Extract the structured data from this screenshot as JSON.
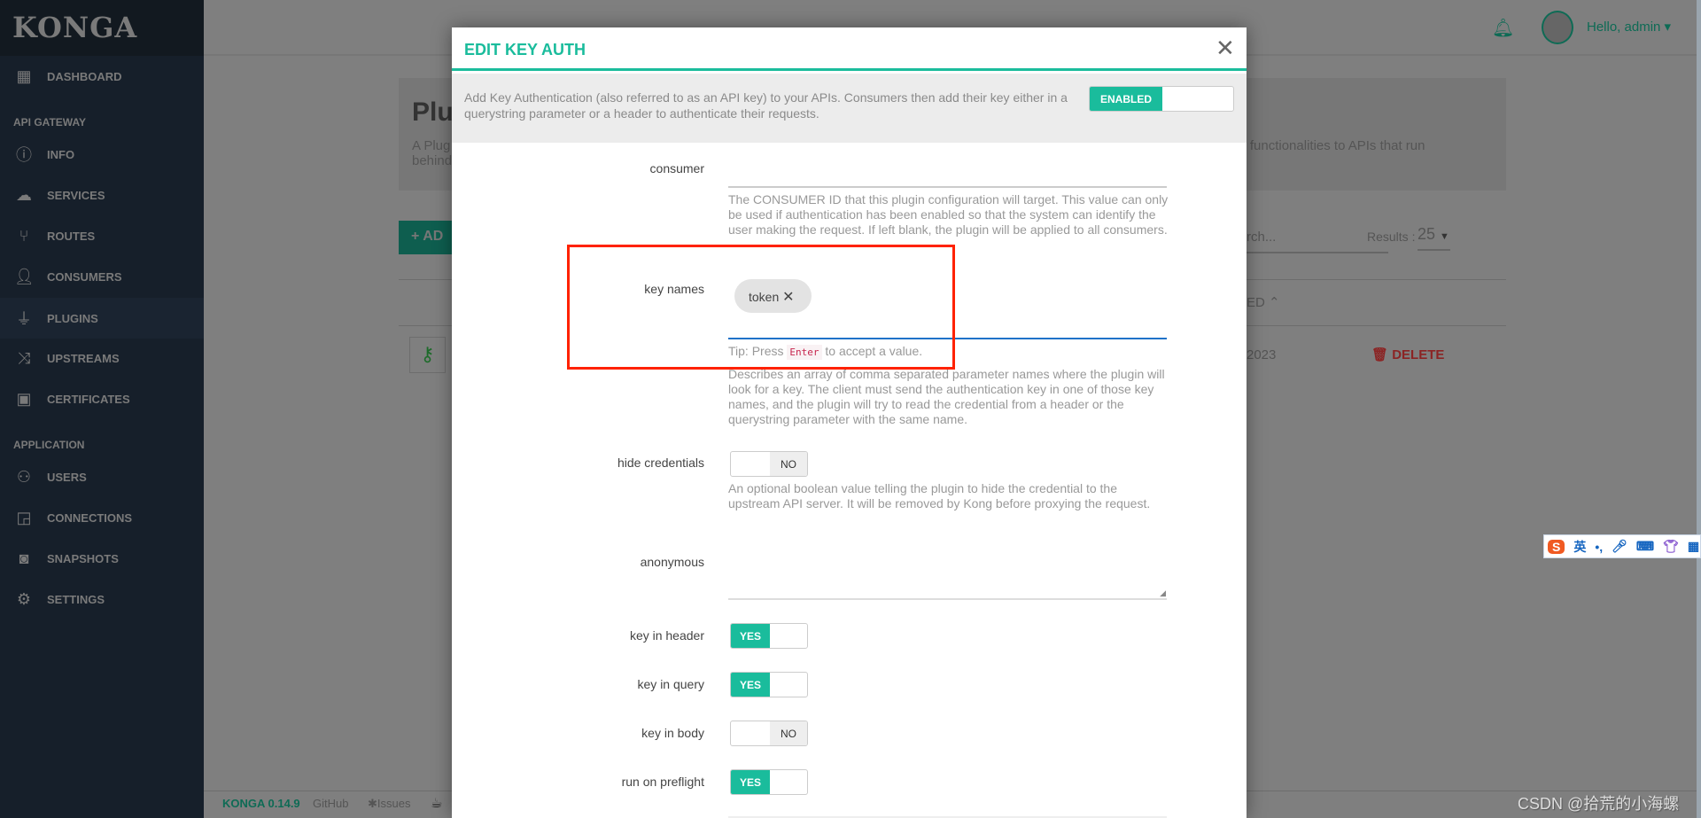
{
  "sidebar": {
    "logo": "KONGA",
    "items": [
      {
        "label": "DASHBOARD",
        "icon": "dashboard-icon"
      },
      {
        "section": "API GATEWAY"
      },
      {
        "label": "INFO",
        "icon": "info-icon"
      },
      {
        "label": "SERVICES",
        "icon": "cloud-icon"
      },
      {
        "label": "ROUTES",
        "icon": "routes-icon"
      },
      {
        "label": "CONSUMERS",
        "icon": "user-icon"
      },
      {
        "label": "PLUGINS",
        "icon": "plug-icon",
        "active": true
      },
      {
        "label": "UPSTREAMS",
        "icon": "shuffle-icon"
      },
      {
        "label": "CERTIFICATES",
        "icon": "certificate-icon"
      },
      {
        "section": "APPLICATION"
      },
      {
        "label": "USERS",
        "icon": "users-icon"
      },
      {
        "label": "CONNECTIONS",
        "icon": "cast-icon"
      },
      {
        "label": "SNAPSHOTS",
        "icon": "camera-icon"
      },
      {
        "label": "SETTINGS",
        "icon": "gear-icon"
      }
    ]
  },
  "header": {
    "greeting": "Hello, admin"
  },
  "page": {
    "title_partial": "Plu",
    "desc_left_1": "A Plug",
    "desc_left_2": "behind",
    "desc_right": "dd functionalities to APIs that run",
    "add_button_partial": "+ AD",
    "search_partial": "rch...",
    "results_label": "Results :",
    "results_value": "25",
    "sort_col_partial": "ED",
    "row_date_partial": "2023",
    "delete_label": "DELETE"
  },
  "footer": {
    "version": "KONGA 0.14.9",
    "github": "GitHub",
    "issues": "Issues"
  },
  "modal": {
    "title": "EDIT KEY AUTH",
    "description": "Add Key Authentication (also referred to as an API key) to your APIs. Consumers then add their key either in a querystring parameter or a header to authenticate their requests.",
    "enabled_label": "ENABLED",
    "fields": {
      "consumer": {
        "label": "consumer",
        "value": "",
        "help": "The CONSUMER ID that this plugin configuration will target. This value can only be used if authentication has been enabled so that the system can identify the user making the request. If left blank, the plugin will be applied to all consumers."
      },
      "key_names": {
        "label": "key names",
        "chips": [
          "token"
        ],
        "tip_pre": "Tip: Press",
        "tip_key": "Enter",
        "tip_post": "to accept a value.",
        "help": "Describes an array of comma separated parameter names where the plugin will look for a key. The client must send the authentication key in one of those key names, and the plugin will try to read the credential from a header or the querystring parameter with the same name."
      },
      "hide_credentials": {
        "label": "hide credentials",
        "value": "NO",
        "help": "An optional boolean value telling the plugin to hide the credential to the upstream API server. It will be removed by Kong before proxying the request."
      },
      "anonymous": {
        "label": "anonymous",
        "value": ""
      },
      "key_in_header": {
        "label": "key in header",
        "value": "YES"
      },
      "key_in_query": {
        "label": "key in query",
        "value": "YES"
      },
      "key_in_body": {
        "label": "key in body",
        "value": "NO"
      },
      "run_on_preflight": {
        "label": "run on preflight",
        "value": "YES"
      }
    }
  },
  "ime": {
    "lang": "英"
  },
  "watermark": "CSDN @拾荒的小海螺",
  "colors": {
    "accent": "#1abc9c",
    "highlight_box": "#ff2200",
    "delete": "#8b2424"
  }
}
